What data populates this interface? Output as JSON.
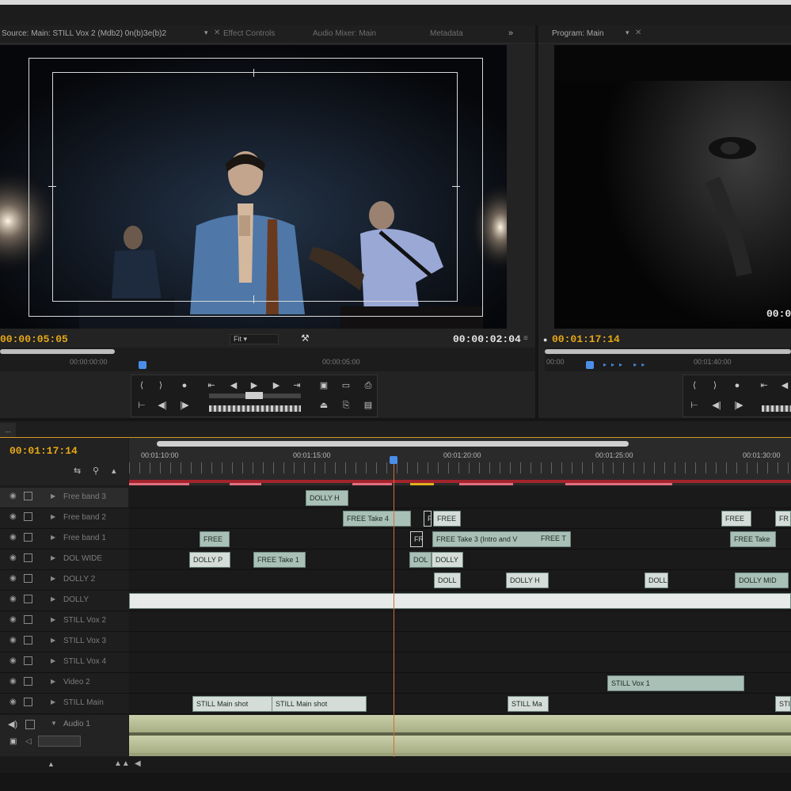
{
  "source_monitor": {
    "tabs": [
      "Source: Main: STILL Vox 2 (Mdb2) 0n(b)3e(b)2",
      "Effect Controls",
      "Audio Mixer: Main",
      "Metadata"
    ],
    "timecode_left": "00:00:05:05",
    "timecode_right": "00:00:02:04",
    "fit_label": "Fit",
    "ruler_label": "00:00:00:00",
    "ruler_label_2": "00:00:05:00"
  },
  "program_monitor": {
    "tab": "Program: Main",
    "timecode": "00:01:17:14",
    "timecode_right": "00:0",
    "ruler_label": "00:00",
    "ruler_label_2": "00:01:40:00"
  },
  "timeline": {
    "tab": "...",
    "timecode": "00:01:17:14",
    "ruler_labels": [
      "00:01:10:00",
      "00:01:15:00",
      "00:01:20:00",
      "00:01:25:00",
      "00:01:30:00"
    ],
    "tracks": [
      {
        "name": "Free band 3"
      },
      {
        "name": "Free band 2"
      },
      {
        "name": "Free band 1"
      },
      {
        "name": "DOL WIDE"
      },
      {
        "name": "DOLLY 2"
      },
      {
        "name": "DOLLY"
      },
      {
        "name": "STILL Vox 2"
      },
      {
        "name": "STILL Vox 3"
      },
      {
        "name": "STILL Vox 4"
      },
      {
        "name": "Video 2"
      },
      {
        "name": "STILL Main"
      }
    ],
    "clips": {
      "t0": [
        "DOLLY H"
      ],
      "t1": [
        "FREE Take 4",
        "F",
        "FREE",
        "FREE",
        "FR"
      ],
      "t2": [
        "FREE",
        "FR",
        "FREE Take 3 (Intro and V",
        "FREE T",
        "FREE Take"
      ],
      "t3": [
        "DOLLY P",
        "FREE Take 1",
        "DOL",
        "DOLLY"
      ],
      "t4": [
        "DOLL",
        "DOLLY H",
        "DOLL",
        "DOLLY MID"
      ],
      "t9": [
        "STILL Vox 1"
      ],
      "t10": [
        "STILL Main shot",
        "STILL Main shot",
        "STILL Ma",
        "STI"
      ]
    },
    "audio_track": {
      "name": "Audio 1"
    }
  }
}
